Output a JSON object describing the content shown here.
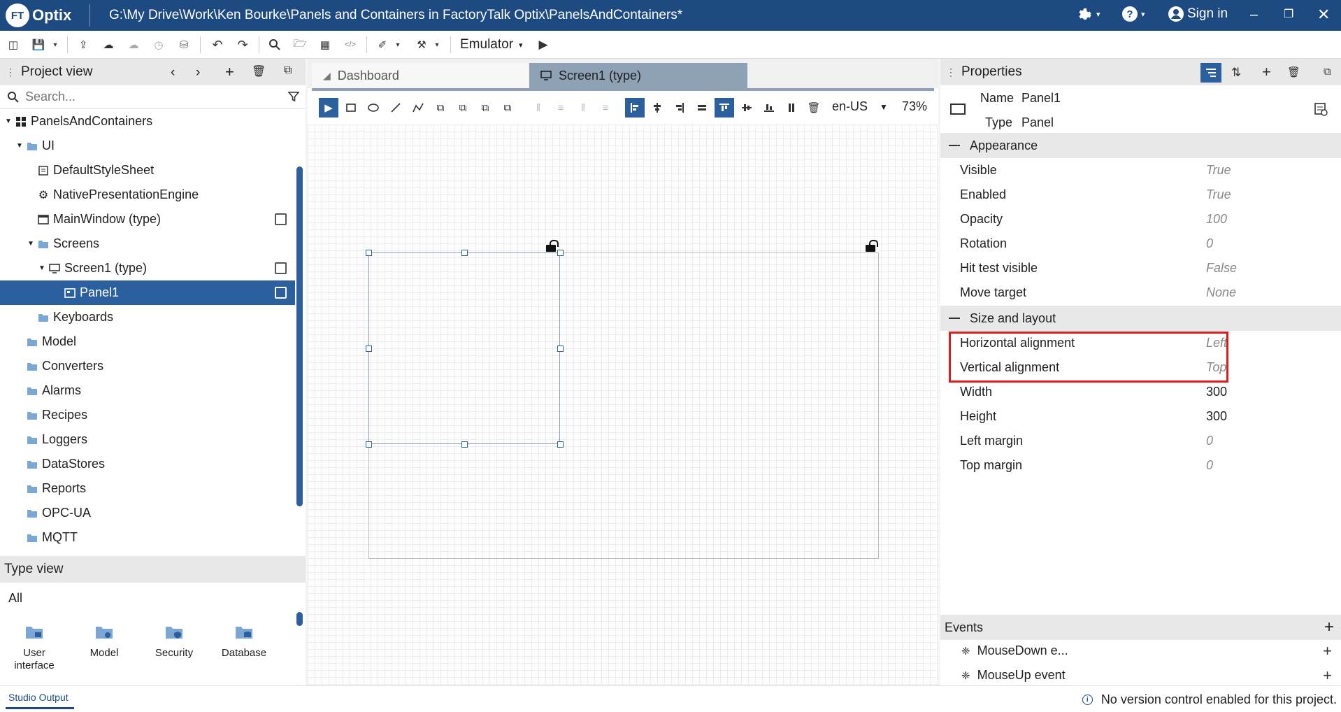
{
  "app": {
    "logo_badge": "FT",
    "logo_text": "Optix",
    "title": "G:\\My Drive\\Work\\Ken Bourke\\Panels and Containers in FactoryTalk Optix\\PanelsAndContainers*",
    "sign_in": "Sign in",
    "accent": "#1e4a82"
  },
  "toolbar": {
    "emulator": "Emulator"
  },
  "project_view": {
    "title": "Project view",
    "search_placeholder": "Search...",
    "tree": [
      {
        "label": "PanelsAndContainers",
        "icon": "project-icon"
      },
      {
        "label": "UI",
        "icon": "folder-icon"
      },
      {
        "label": "DefaultStyleSheet",
        "icon": "stylesheet-icon"
      },
      {
        "label": "NativePresentationEngine",
        "icon": "gear-icon"
      },
      {
        "label": "MainWindow (type)",
        "icon": "window-icon"
      },
      {
        "label": "Screens",
        "icon": "folder-icon"
      },
      {
        "label": "Screen1 (type)",
        "icon": "monitor-icon"
      },
      {
        "label": "Panel1",
        "icon": "panel-icon"
      },
      {
        "label": "Keyboards",
        "icon": "folder-icon"
      },
      {
        "label": "Model",
        "icon": "folder-icon"
      },
      {
        "label": "Converters",
        "icon": "folder-icon"
      },
      {
        "label": "Alarms",
        "icon": "folder-icon"
      },
      {
        "label": "Recipes",
        "icon": "folder-icon"
      },
      {
        "label": "Loggers",
        "icon": "folder-icon"
      },
      {
        "label": "DataStores",
        "icon": "folder-icon"
      },
      {
        "label": "Reports",
        "icon": "folder-icon"
      },
      {
        "label": "OPC-UA",
        "icon": "folder-icon"
      },
      {
        "label": "MQTT",
        "icon": "folder-icon"
      }
    ]
  },
  "type_view": {
    "title": "Type view",
    "filter": "All",
    "items": [
      {
        "label": "User interface"
      },
      {
        "label": "Model"
      },
      {
        "label": "Security"
      },
      {
        "label": "Database"
      }
    ]
  },
  "editor": {
    "tabs": [
      {
        "label": "Dashboard"
      },
      {
        "label": "Screen1 (type)"
      }
    ],
    "language": "en-US",
    "zoom": "73%"
  },
  "properties": {
    "title": "Properties",
    "name_label": "Name",
    "name_value": "Panel1",
    "type_label": "Type",
    "type_value": "Panel",
    "sections": [
      {
        "title": "Appearance",
        "rows": [
          {
            "label": "Visible",
            "value": "True"
          },
          {
            "label": "Enabled",
            "value": "True"
          },
          {
            "label": "Opacity",
            "value": "100"
          },
          {
            "label": "Rotation",
            "value": "0"
          },
          {
            "label": "Hit test visible",
            "value": "False"
          },
          {
            "label": "Move target",
            "value": "None"
          }
        ]
      },
      {
        "title": "Size and layout",
        "rows": [
          {
            "label": "Horizontal alignment",
            "value": "Left"
          },
          {
            "label": "Vertical alignment",
            "value": "Top"
          },
          {
            "label": "Width",
            "value": "300"
          },
          {
            "label": "Height",
            "value": "300"
          },
          {
            "label": "Left margin",
            "value": "0"
          },
          {
            "label": "Top margin",
            "value": "0"
          }
        ]
      }
    ],
    "highlight_color": "#e0191d"
  },
  "events": {
    "title": "Events",
    "items": [
      {
        "label": "MouseDown e..."
      },
      {
        "label": "MouseUp event"
      }
    ]
  },
  "status": {
    "output_tab": "Studio Output",
    "message": "No version control enabled for this project."
  }
}
